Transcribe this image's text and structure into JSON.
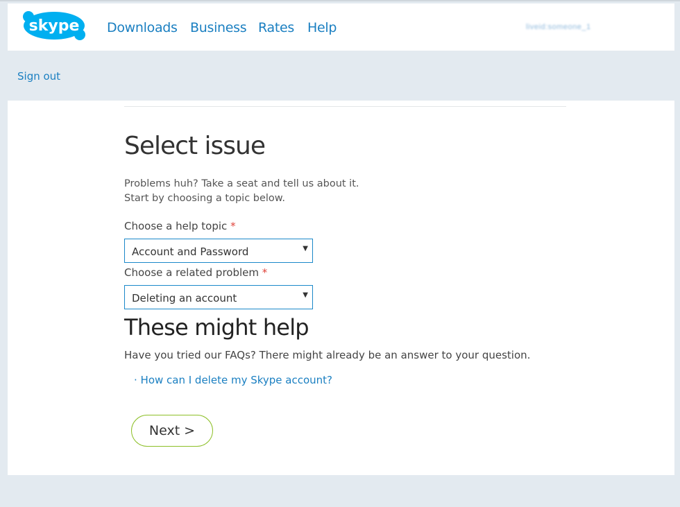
{
  "header": {
    "logo_text": "skype",
    "nav": [
      "Downloads",
      "Business",
      "Rates",
      "Help"
    ],
    "username": "liveid:someone_1"
  },
  "account": {
    "sign_out": "Sign out"
  },
  "form": {
    "title": "Select issue",
    "intro_line1": "Problems huh? Take a seat and tell us about it.",
    "intro_line2": "Start by choosing a topic below.",
    "topic_label": "Choose a help topic",
    "topic_value": "Account and Password",
    "problem_label": "Choose a related problem",
    "problem_value": "Deleting an account",
    "required_mark": "*"
  },
  "help": {
    "title": "These might help",
    "text": "Have you tried our FAQs? There might already be an answer to your question.",
    "link": "· How can I delete my Skype account?"
  },
  "next_button": "Next >",
  "colors": {
    "link": "#1a7fc1",
    "accent_green": "#8cbf26",
    "skype_blue": "#00aff0"
  }
}
